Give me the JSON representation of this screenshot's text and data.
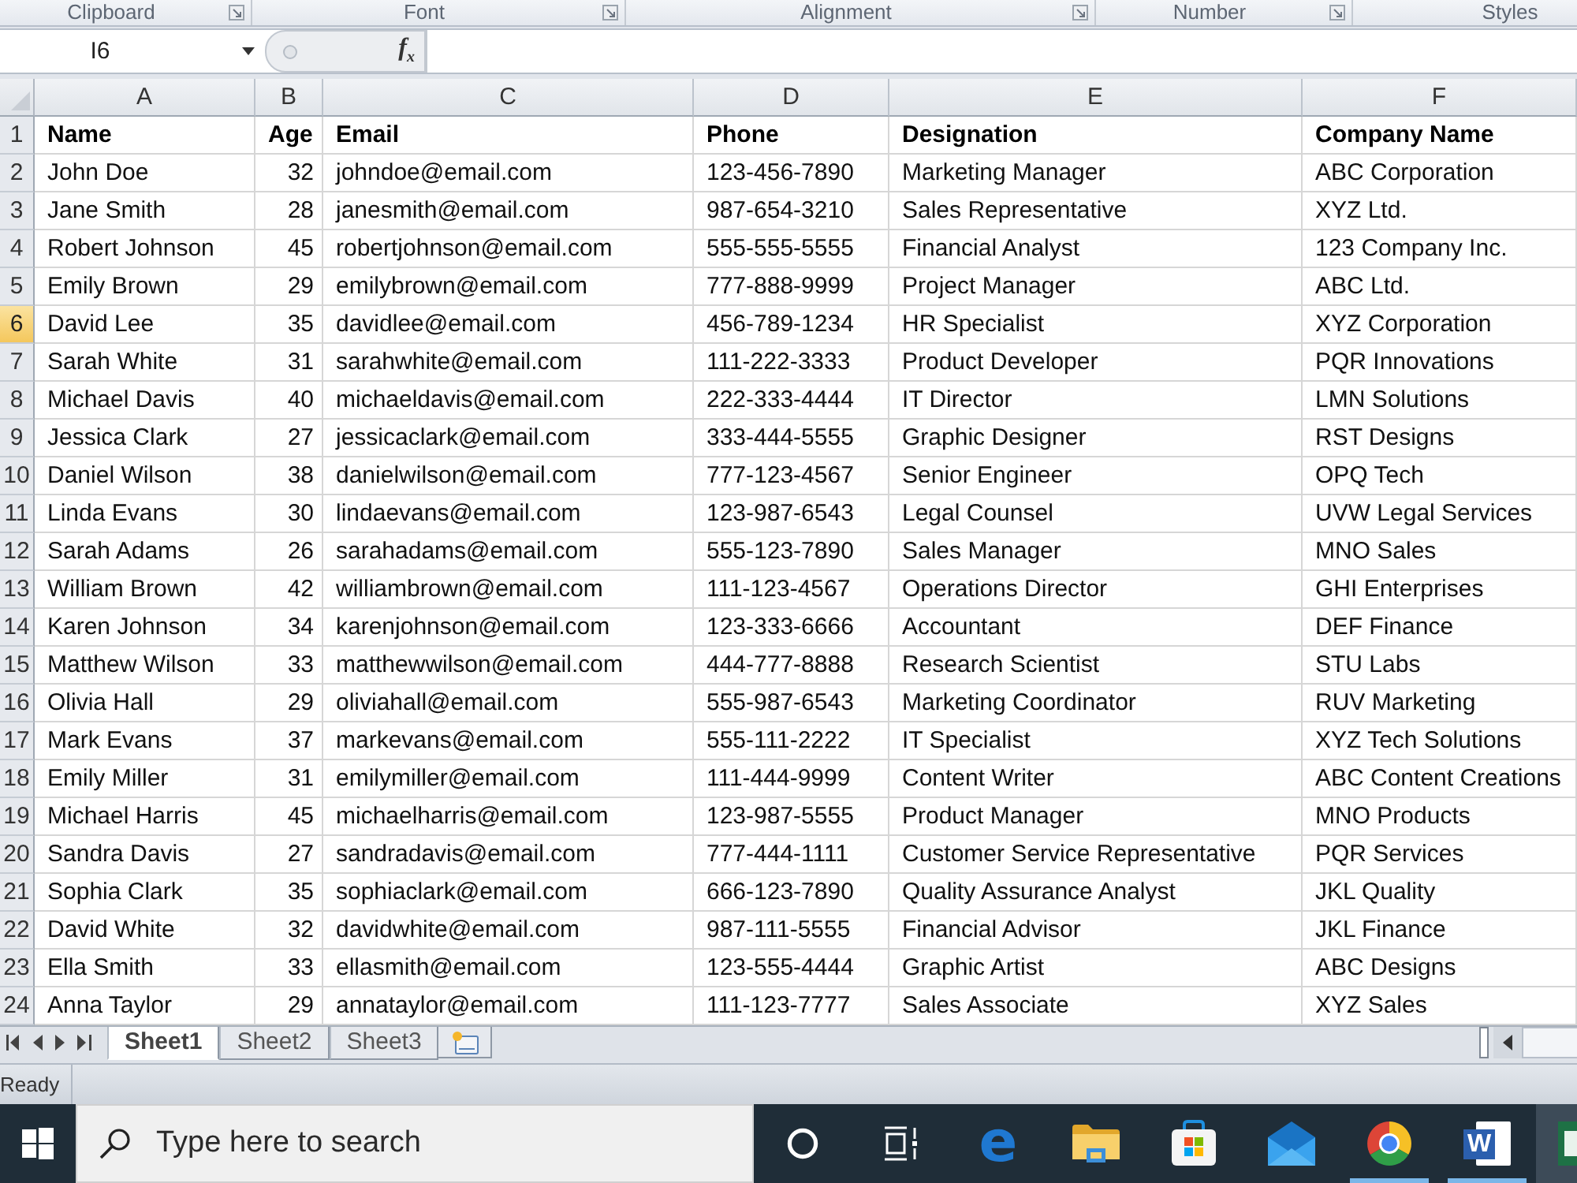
{
  "ribbon": {
    "groups": [
      {
        "label": "Clipboard",
        "launcher": true
      },
      {
        "label": "Font",
        "launcher": true
      },
      {
        "label": "Alignment",
        "launcher": true
      },
      {
        "label": "Number",
        "launcher": true
      },
      {
        "label": "Styles",
        "launcher": false
      }
    ]
  },
  "formula_bar": {
    "name_box": "I6",
    "function_button": "f$_{x}$"
  },
  "sheet": {
    "columns": [
      {
        "letter": "A",
        "kind": "text"
      },
      {
        "letter": "B",
        "kind": "number"
      },
      {
        "letter": "C",
        "kind": "text"
      },
      {
        "letter": "D",
        "kind": "text"
      },
      {
        "letter": "E",
        "kind": "text"
      },
      {
        "letter": "F",
        "kind": "text"
      }
    ],
    "rows": [
      {
        "number": "1",
        "kind": "header",
        "selected": false,
        "cells": [
          "Name",
          "Age",
          "Email",
          "Phone",
          "Designation",
          "Company Name"
        ]
      },
      {
        "number": "2",
        "kind": "data",
        "selected": false,
        "cells": [
          "John Doe",
          "32",
          "johndoe@email.com",
          "123-456-7890",
          "Marketing Manager",
          "ABC Corporation"
        ]
      },
      {
        "number": "3",
        "kind": "data",
        "selected": false,
        "cells": [
          "Jane Smith",
          "28",
          "janesmith@email.com",
          "987-654-3210",
          "Sales Representative",
          "XYZ Ltd."
        ]
      },
      {
        "number": "4",
        "kind": "data",
        "selected": false,
        "cells": [
          "Robert Johnson",
          "45",
          "robertjohnson@email.com",
          "555-555-5555",
          "Financial Analyst",
          "123 Company Inc."
        ]
      },
      {
        "number": "5",
        "kind": "data",
        "selected": false,
        "cells": [
          "Emily Brown",
          "29",
          "emilybrown@email.com",
          "777-888-9999",
          "Project Manager",
          "ABC Ltd."
        ]
      },
      {
        "number": "6",
        "kind": "data",
        "selected": true,
        "cells": [
          "David Lee",
          "35",
          "davidlee@email.com",
          "456-789-1234",
          "HR Specialist",
          "XYZ Corporation"
        ]
      },
      {
        "number": "7",
        "kind": "data",
        "selected": false,
        "cells": [
          "Sarah White",
          "31",
          "sarahwhite@email.com",
          "111-222-3333",
          "Product Developer",
          "PQR Innovations"
        ]
      },
      {
        "number": "8",
        "kind": "data",
        "selected": false,
        "cells": [
          "Michael Davis",
          "40",
          "michaeldavis@email.com",
          "222-333-4444",
          "IT Director",
          "LMN Solutions"
        ]
      },
      {
        "number": "9",
        "kind": "data",
        "selected": false,
        "cells": [
          "Jessica Clark",
          "27",
          "jessicaclark@email.com",
          "333-444-5555",
          "Graphic Designer",
          "RST Designs"
        ]
      },
      {
        "number": "10",
        "kind": "data",
        "selected": false,
        "cells": [
          "Daniel Wilson",
          "38",
          "danielwilson@email.com",
          "777-123-4567",
          "Senior Engineer",
          "OPQ Tech"
        ]
      },
      {
        "number": "11",
        "kind": "data",
        "selected": false,
        "cells": [
          "Linda Evans",
          "30",
          "lindaevans@email.com",
          "123-987-6543",
          "Legal Counsel",
          "UVW Legal Services"
        ]
      },
      {
        "number": "12",
        "kind": "data",
        "selected": false,
        "cells": [
          "Sarah Adams",
          "26",
          "sarahadams@email.com",
          "555-123-7890",
          "Sales Manager",
          "MNO Sales"
        ]
      },
      {
        "number": "13",
        "kind": "data",
        "selected": false,
        "cells": [
          "William Brown",
          "42",
          "williambrown@email.com",
          "111-123-4567",
          "Operations Director",
          "GHI Enterprises"
        ]
      },
      {
        "number": "14",
        "kind": "data",
        "selected": false,
        "cells": [
          "Karen Johnson",
          "34",
          "karenjohnson@email.com",
          "123-333-6666",
          "Accountant",
          "DEF Finance"
        ]
      },
      {
        "number": "15",
        "kind": "data",
        "selected": false,
        "cells": [
          "Matthew Wilson",
          "33",
          "matthewwilson@email.com",
          "444-777-8888",
          "Research Scientist",
          "STU Labs"
        ]
      },
      {
        "number": "16",
        "kind": "data",
        "selected": false,
        "cells": [
          "Olivia Hall",
          "29",
          "oliviahall@email.com",
          "555-987-6543",
          "Marketing Coordinator",
          "RUV Marketing"
        ]
      },
      {
        "number": "17",
        "kind": "data",
        "selected": false,
        "cells": [
          "Mark Evans",
          "37",
          "markevans@email.com",
          "555-111-2222",
          "IT Specialist",
          "XYZ Tech Solutions"
        ]
      },
      {
        "number": "18",
        "kind": "data",
        "selected": false,
        "cells": [
          "Emily Miller",
          "31",
          "emilymiller@email.com",
          "111-444-9999",
          "Content Writer",
          "ABC Content Creations"
        ]
      },
      {
        "number": "19",
        "kind": "data",
        "selected": false,
        "cells": [
          "Michael Harris",
          "45",
          "michaelharris@email.com",
          "123-987-5555",
          "Product Manager",
          "MNO Products"
        ]
      },
      {
        "number": "20",
        "kind": "data",
        "selected": false,
        "cells": [
          "Sandra Davis",
          "27",
          "sandradavis@email.com",
          "777-444-1111",
          "Customer Service Representative",
          "PQR Services"
        ]
      },
      {
        "number": "21",
        "kind": "data",
        "selected": false,
        "cells": [
          "Sophia Clark",
          "35",
          "sophiaclark@email.com",
          "666-123-7890",
          "Quality Assurance Analyst",
          "JKL Quality"
        ]
      },
      {
        "number": "22",
        "kind": "data",
        "selected": false,
        "cells": [
          "David White",
          "32",
          "davidwhite@email.com",
          "987-111-5555",
          "Financial Advisor",
          "JKL Finance"
        ]
      },
      {
        "number": "23",
        "kind": "data",
        "selected": false,
        "cells": [
          "Ella Smith",
          "33",
          "ellasmith@email.com",
          "123-555-4444",
          "Graphic Artist",
          "ABC Designs"
        ]
      },
      {
        "number": "24",
        "kind": "data",
        "selected": false,
        "cells": [
          "Anna Taylor",
          "29",
          "annataylor@email.com",
          "111-123-7777",
          "Sales Associate",
          "XYZ Sales"
        ]
      }
    ]
  },
  "sheet_tabs": [
    {
      "label": "Sheet1",
      "selected": true
    },
    {
      "label": "Sheet2",
      "selected": false
    },
    {
      "label": "Sheet3",
      "selected": false
    }
  ],
  "status_bar": {
    "text": "Ready"
  },
  "taskbar": {
    "search": {
      "placeholder": "Type here to search"
    },
    "apps": [
      {
        "kind": "cortana",
        "running": false,
        "active": false
      },
      {
        "kind": "task_view",
        "running": false,
        "active": false
      },
      {
        "kind": "browser_e",
        "glyph": "e",
        "running": false,
        "active": false
      },
      {
        "kind": "folder",
        "running": false,
        "active": false
      },
      {
        "kind": "store",
        "running": false,
        "active": false
      },
      {
        "kind": "mail",
        "running": false,
        "active": false
      },
      {
        "kind": "chrome",
        "running": true,
        "active": false
      },
      {
        "kind": "word",
        "glyph": "W",
        "running": true,
        "active": false
      },
      {
        "kind": "excel",
        "running": false,
        "active": true
      }
    ]
  }
}
